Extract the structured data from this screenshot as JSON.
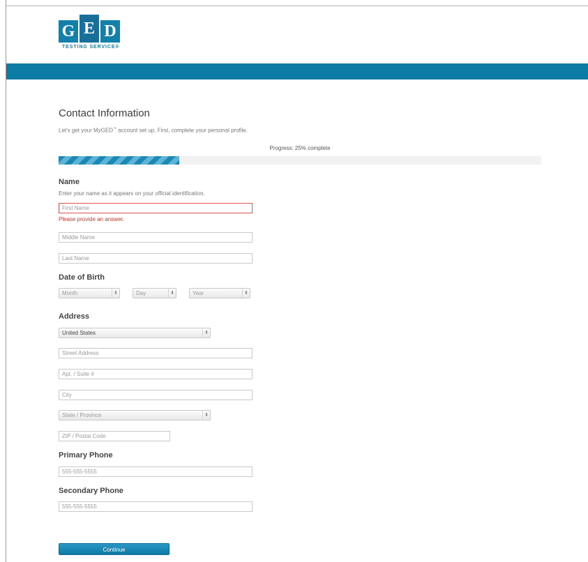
{
  "logo": {
    "letters": [
      "G",
      "E",
      "D"
    ],
    "subtitle": "TESTING SERVICE®"
  },
  "colors": {
    "brand_blue": "#0d7ca4",
    "error_red": "#c0392b",
    "button_blue": "#1a8ab6"
  },
  "form": {
    "title": "Contact Information",
    "subtitle_pre": "Let's get your MyGED",
    "subtitle_tm": "™",
    "subtitle_post": " account set up. First, complete your personal profile.",
    "progress": {
      "label": "Progress: 25% complete",
      "percent": 25
    },
    "name_section": {
      "heading": "Name",
      "hint": "Enter your name as it appears on your official identification.",
      "first_name": {
        "placeholder": "First Name",
        "value": ""
      },
      "first_name_error": "Please provide an answer.",
      "middle_name": {
        "placeholder": "Middle Name",
        "value": ""
      },
      "last_name": {
        "placeholder": "Last Name",
        "value": ""
      }
    },
    "dob_section": {
      "heading": "Date of Birth",
      "month": "Month",
      "day": "Day",
      "year": "Year",
      "arrow_icon": "updown-chevron-icon"
    },
    "address_section": {
      "heading": "Address",
      "country": "United States",
      "street": {
        "placeholder": "Street Address"
      },
      "apt": {
        "placeholder": "Apt. / Suite #"
      },
      "city": {
        "placeholder": "City"
      },
      "state": "State / Province",
      "zip": {
        "placeholder": "ZIP / Postal Code"
      }
    },
    "primary_phone": {
      "heading": "Primary Phone",
      "placeholder": "555-555-5555"
    },
    "secondary_phone": {
      "heading": "Secondary Phone",
      "placeholder": "555-555-5555"
    },
    "continue_label": "Continue"
  }
}
